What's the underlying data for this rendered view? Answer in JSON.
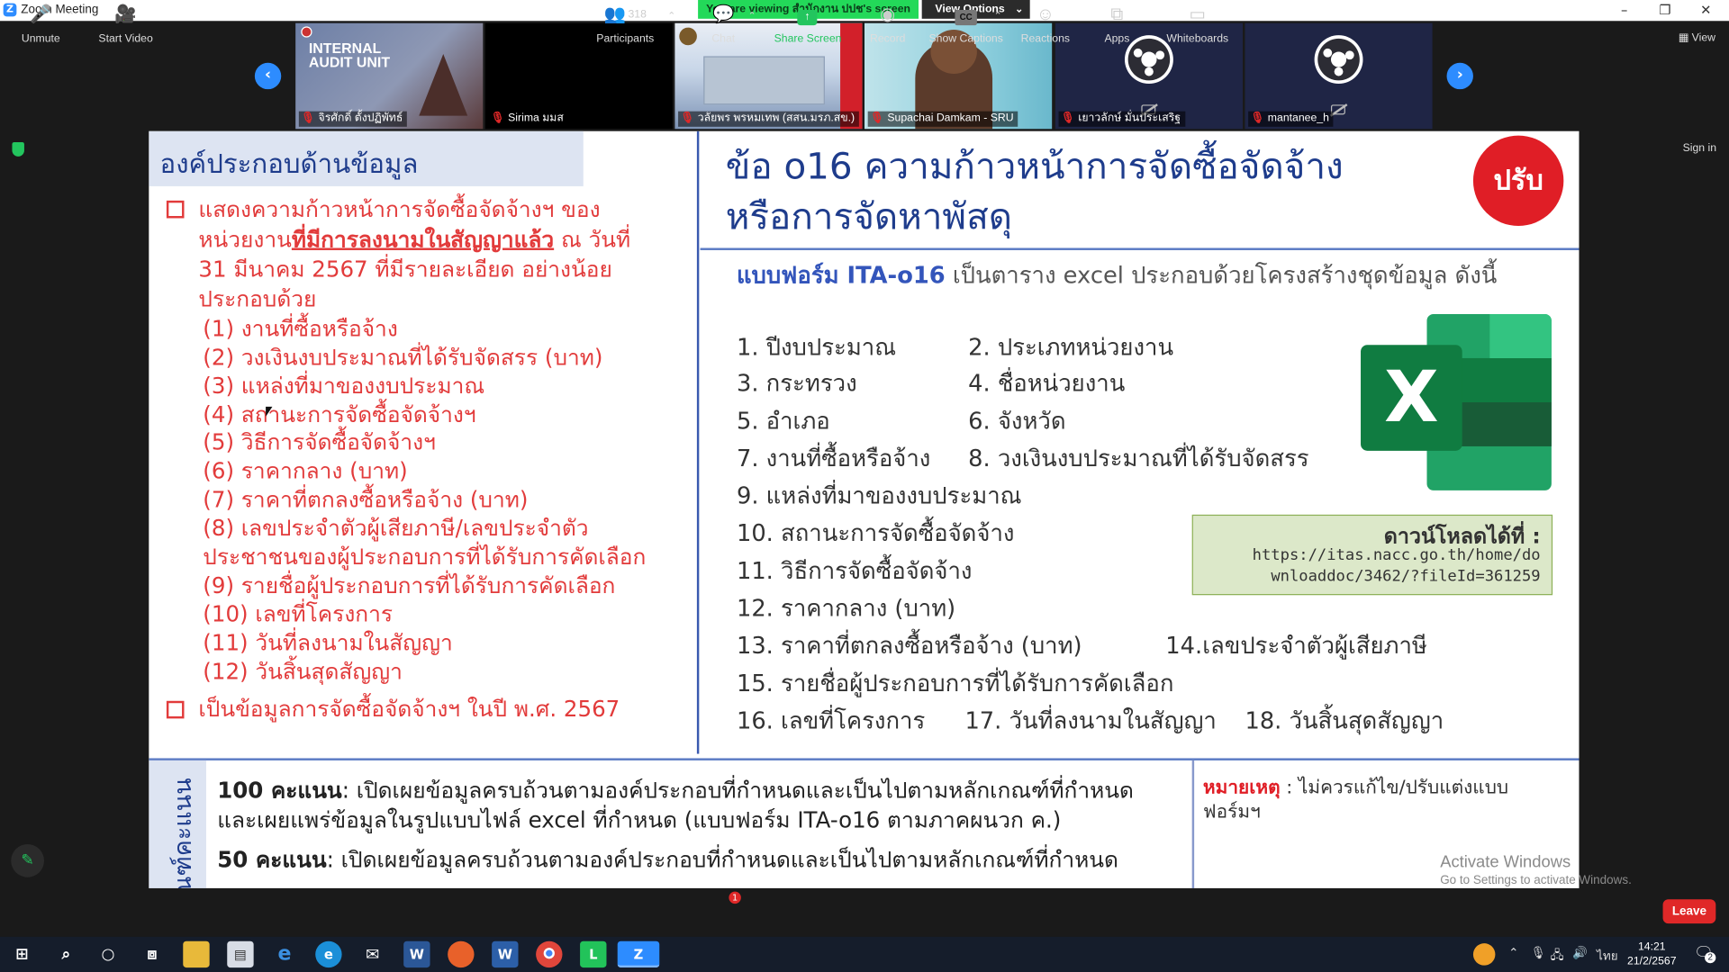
{
  "window": {
    "title": "Zoom Meeting",
    "minimize": "–",
    "maximize": "❐",
    "close": "✕"
  },
  "share_banner": {
    "text": "You are viewing สำนักงาน ปปช's screen",
    "view_options": "View Options",
    "view_options_caret": "⌄"
  },
  "gallery": {
    "prev_arrow": "‹",
    "next_arrow": "›",
    "participants": [
      {
        "name": "จิรศักดิ์ ตั้งปฏิพัทธ์",
        "muted": true,
        "video": "internal-audit-unit-image",
        "overlay": "INTERNAL AUDIT UNIT"
      },
      {
        "name": "Sirima มมส",
        "muted": true,
        "video": "black"
      },
      {
        "name": "วลัยพร พรหมเทพ (สสน.มรภ.สข.)",
        "muted": true,
        "video": "building-image"
      },
      {
        "name": "Supachai Damkam - SRU",
        "muted": true,
        "video": "camera"
      },
      {
        "name": "เยาวลักษ์ มั่นประเสริฐ",
        "muted": true,
        "video": "obs-logo-video-off"
      },
      {
        "name": "mantanee_h",
        "muted": true,
        "video": "obs-logo-video-off"
      }
    ]
  },
  "side": {
    "view_label": "View",
    "sign_in": "Sign in"
  },
  "slide": {
    "left_header": "องค์ประกอบด้านข้อมูล",
    "bullet1": {
      "line1": "แสดงความก้าวหน้าการจัดซื้อจัดจ้างฯ ของ",
      "line2_pre": "หน่วยงาน",
      "line2_underlined": "ที่มีการลงนามในสัญญาแล้ว",
      "line2_post": " ณ วันที่",
      "line3": "31 มีนาคม 2567 ที่มีรายละเอียด อย่างน้อย",
      "line4": "ประกอบด้วย"
    },
    "sub_items": [
      "(1) งานที่ซื้อหรือจ้าง",
      "(2) วงเงินงบประมาณที่ได้รับจัดสรร (บาท)",
      "(3) แหล่งที่มาของงบประมาณ",
      "(4) สถานะการจัดซื้อจัดจ้างฯ",
      "(5) วิธีการจัดซื้อจัดจ้างฯ",
      "(6) ราคากลาง (บาท)",
      "(7) ราคาที่ตกลงซื้อหรือจ้าง (บาท)",
      "(8) เลขประจำตัวผู้เสียภาษี/เลขประจำตัว",
      "ประชาชนของผู้ประกอบการที่ได้รับการคัดเลือก",
      "(9) รายชื่อผู้ประกอบการที่ได้รับการคัดเลือก",
      "(10) เลขที่โครงการ",
      "(11) วันที่ลงนามในสัญญา",
      "(12) วันสิ้นสุดสัญญา"
    ],
    "bullet2": "เป็นข้อมูลการจัดซื้อจัดจ้างฯ ในปี พ.ศ. 2567",
    "title_line1": "ข้อ o16 ความก้าวหน้าการจัดซื้อจัดจ้าง",
    "title_line2": "หรือการจัดหาพัสดุ",
    "badge": "ปรับ",
    "form_bold": "แบบฟอร์ม ITA-o16",
    "form_rest": " เป็นตาราง excel ประกอบด้วยโครงสร้างชุดข้อมูล ดังนี้",
    "items": [
      "1. ปีงบประมาณ",
      "2. ประเภทหน่วยงาน",
      "3. กระทรวง",
      "4. ชื่อหน่วยงาน",
      "5. อำเภอ",
      "6. จังหวัด",
      "7. งานที่ซื้อหรือจ้าง",
      "8. วงเงินงบประมาณที่ได้รับจัดสรร",
      "9. แหล่งที่มาของงบประมาณ",
      "10. สถานะการจัดซื้อจัดจ้าง",
      "11. วิธีการจัดซื้อจัดจ้าง",
      "12. ราคากลาง (บาท)",
      "13. ราคาที่ตกลงซื้อหรือจ้าง (บาท)",
      "14.เลขประจำตัวผู้เสียภาษี",
      "15. รายชื่อผู้ประกอบการที่ได้รับการคัดเลือก",
      "16. เลขที่โครงการ",
      "17. วันที่ลงนามในสัญญา",
      "18. วันสิ้นสุดสัญญา"
    ],
    "download_header": "ดาวน์โหลดได้ที่ :",
    "download_url1": "https://itas.nacc.go.th/home/do",
    "download_url2": "wnloaddoc/3462/?fileId=361259",
    "score_strip": "เกณฑ์คะแนน",
    "score100_bold": "100 คะแนน",
    "score100_text": ": เปิดเผยข้อมูลครบถ้วนตามองค์ประกอบที่กำหนดและเป็นไปตามหลักเกณฑ์ที่กำหนด",
    "score100_line2": "และเผยแพร่ข้อมูลในรูปแบบไฟล์ excel ที่กำหนด (แบบฟอร์ม ITA-o16 ตามภาคผนวก ค.)",
    "score50_bold": "50 คะแนน",
    "score50_text": ": เปิดเผยข้อมูลครบถ้วนตามองค์ประกอบที่กำหนดและเป็นไปตามหลักเกณฑ์ที่กำหนด",
    "note_label": "หมายเหตุ",
    "note_text": " : ไม่ควรแก้ไข/ปรับแต่งแบบฟอร์มฯ"
  },
  "watermark": {
    "line1": "Activate Windows",
    "line2": "Go to Settings to activate Windows."
  },
  "toolbar": {
    "unmute": "Unmute",
    "start_video": "Start Video",
    "participants": "Participants",
    "participant_count": "318",
    "chat": "Chat",
    "chat_badge": "1",
    "share_screen": "Share Screen",
    "record": "Record",
    "show_captions": "Show Captions",
    "reactions": "Reactions",
    "apps": "Apps",
    "whiteboards": "Whiteboards",
    "leave": "Leave"
  },
  "taskbar": {
    "time": "14:21",
    "date": "21/2/2567",
    "ime": "ไทย",
    "notif_count": "2"
  },
  "colors": {
    "zoom_blue": "#2d8cff",
    "share_green": "#23d959",
    "slide_red": "#e23b3b",
    "slide_blue": "#1e3c8c",
    "leave_red": "#e02828"
  }
}
